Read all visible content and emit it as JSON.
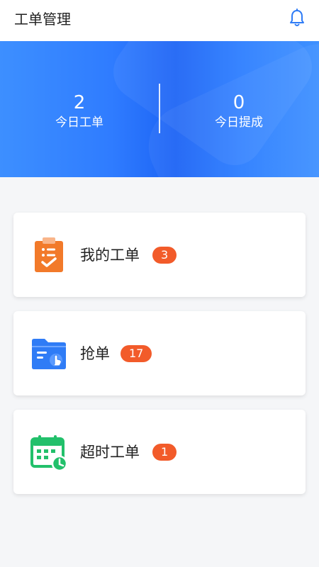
{
  "header": {
    "title": "工单管理",
    "bell_icon": "bell-icon"
  },
  "stats": {
    "today_orders": {
      "value": "2",
      "label": "今日工单"
    },
    "today_commission": {
      "value": "0",
      "label": "今日提成"
    }
  },
  "cards": [
    {
      "label": "我的工单",
      "count": "3",
      "icon": "clipboard-check-icon",
      "icon_color": "#f27a2a"
    },
    {
      "label": "抢单",
      "count": "17",
      "icon": "folder-tap-icon",
      "icon_color": "#2f7cf6"
    },
    {
      "label": "超时工单",
      "count": "1",
      "icon": "calendar-clock-icon",
      "icon_color": "#22c06b"
    }
  ],
  "colors": {
    "primary": "#2f7cff",
    "badge": "#f25b2a"
  }
}
